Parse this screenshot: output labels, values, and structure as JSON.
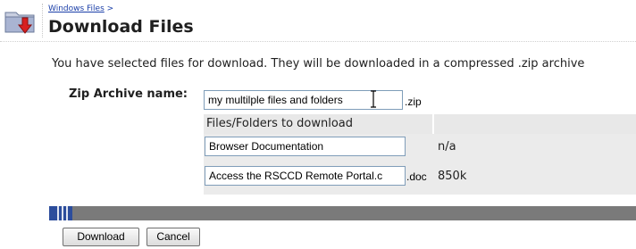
{
  "header": {
    "breadcrumb_link": "Windows Files",
    "breadcrumb_sep": ">",
    "title": "Download Files",
    "icon": "download-folder-icon"
  },
  "description": "You have selected files for download. They will be downloaded in a compressed .zip archive",
  "zip": {
    "label": "Zip Archive name:",
    "value": "my multilple files and folders",
    "ext": ".zip"
  },
  "table": {
    "header": "Files/Folders to download",
    "rows": [
      {
        "name": "Browser Documentation",
        "ext": "",
        "size": "n/a"
      },
      {
        "name": "Access the RSCCD Remote Portal.c",
        "ext": ".doc",
        "size": "850k"
      }
    ]
  },
  "progress": {
    "percent": 4
  },
  "buttons": {
    "download": "Download",
    "cancel": "Cancel"
  },
  "colors": {
    "link": "#1a3ea8",
    "progress_fill": "#2c4d9c",
    "progress_track": "#7a7a7a"
  }
}
